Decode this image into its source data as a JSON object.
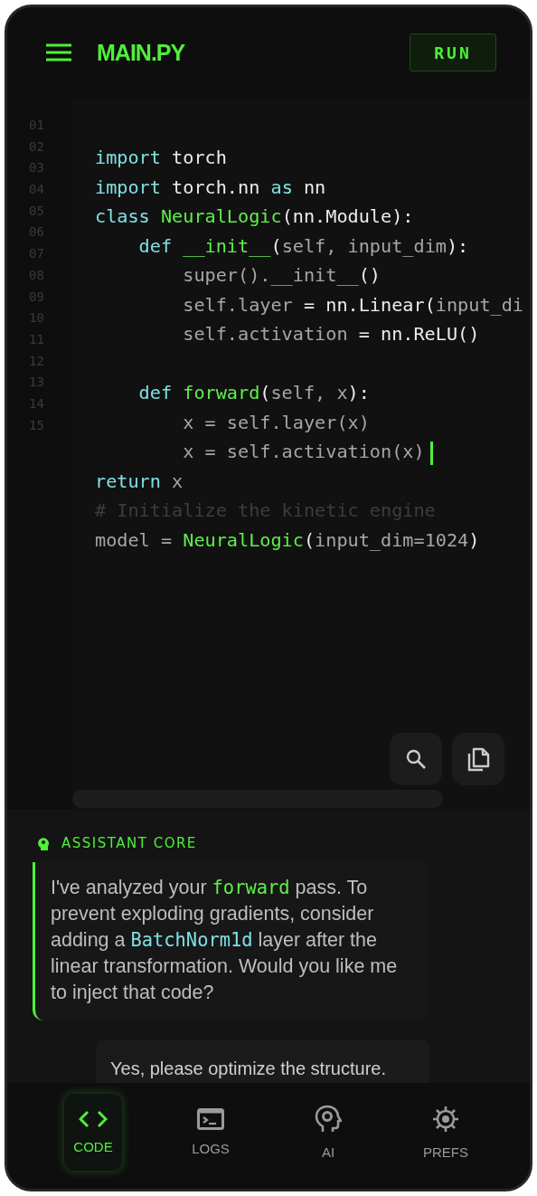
{
  "header": {
    "title": "MAIN.PY",
    "run_button": "RUN"
  },
  "editor": {
    "line_numbers": [
      "01",
      "02",
      "03",
      "04",
      "05",
      "06",
      "07",
      "08",
      "09",
      "10",
      "11",
      "12",
      "13",
      "14",
      "15"
    ],
    "lines": [
      {
        "kind": "code",
        "cursor": false,
        "tokens": [
          {
            "text": "import",
            "kind": "keyword"
          },
          {
            "text": " torch",
            "kind": "plain"
          }
        ]
      },
      {
        "kind": "code",
        "cursor": false,
        "tokens": [
          {
            "text": "import",
            "kind": "keyword"
          },
          {
            "text": " torch.nn ",
            "kind": "plain"
          },
          {
            "text": "as",
            "kind": "keyword"
          },
          {
            "text": " nn",
            "kind": "plain"
          }
        ]
      },
      {
        "kind": "code",
        "cursor": false,
        "tokens": [
          {
            "text": "class",
            "kind": "keyword"
          },
          {
            "text": " NeuralLogic",
            "kind": "function"
          },
          {
            "text": "(nn.Module):",
            "kind": "plain"
          }
        ]
      },
      {
        "kind": "code",
        "cursor": false,
        "tokens": [
          {
            "text": "    def",
            "kind": "keyword"
          },
          {
            "text": " __init__",
            "kind": "function"
          },
          {
            "text": "(",
            "kind": "plain"
          },
          {
            "text": "self, input_dim",
            "kind": "muted"
          },
          {
            "text": "):",
            "kind": "plain"
          }
        ]
      },
      {
        "kind": "code",
        "cursor": false,
        "tokens": [
          {
            "text": "        super().__init__",
            "kind": "muted"
          },
          {
            "text": "()",
            "kind": "plain"
          }
        ]
      },
      {
        "kind": "code",
        "cursor": false,
        "tokens": [
          {
            "text": "        self.layer",
            "kind": "muted"
          },
          {
            "text": " = nn.Linear(",
            "kind": "plain"
          },
          {
            "text": "input_di",
            "kind": "muted"
          }
        ]
      },
      {
        "kind": "code",
        "cursor": false,
        "tokens": [
          {
            "text": "        self.activation",
            "kind": "muted"
          },
          {
            "text": " = nn.ReLU()",
            "kind": "plain"
          }
        ]
      },
      {
        "kind": "blank",
        "cursor": false
      },
      {
        "kind": "code",
        "cursor": false,
        "tokens": [
          {
            "text": "    def",
            "kind": "keyword"
          },
          {
            "text": " forward",
            "kind": "function"
          },
          {
            "text": "(",
            "kind": "plain"
          },
          {
            "text": "self, x",
            "kind": "muted"
          },
          {
            "text": "):",
            "kind": "plain"
          }
        ]
      },
      {
        "kind": "code",
        "cursor": false,
        "tokens": [
          {
            "text": "        x = self.layer(x)",
            "kind": "muted"
          }
        ]
      },
      {
        "kind": "code",
        "cursor": true,
        "tokens": [
          {
            "text": "        x = self.activation(x)",
            "kind": "muted"
          }
        ]
      },
      {
        "kind": "code",
        "cursor": false,
        "tokens": [
          {
            "text": "return",
            "kind": "keyword"
          },
          {
            "text": " x",
            "kind": "muted"
          }
        ]
      },
      {
        "kind": "code",
        "cursor": false,
        "tokens": [
          {
            "text": "# Initialize the kinetic engine",
            "kind": "comment"
          }
        ]
      },
      {
        "kind": "code",
        "cursor": false,
        "tokens": [
          {
            "text": "model = ",
            "kind": "muted"
          },
          {
            "text": "NeuralLogic",
            "kind": "function"
          },
          {
            "text": "(",
            "kind": "plain"
          },
          {
            "text": "input_dim=1024",
            "kind": "muted"
          },
          {
            "text": ")",
            "kind": "plain"
          }
        ]
      }
    ]
  },
  "assistant": {
    "label": "ASSISTANT CORE",
    "message": [
      {
        "text": "I've analyzed your ",
        "kind": "plain"
      },
      {
        "text": "forward",
        "kind": "code_green"
      },
      {
        "text": " pass. To prevent exploding gradients, consider adding a ",
        "kind": "plain"
      },
      {
        "text": "BatchNorm1d",
        "kind": "code_cyan"
      },
      {
        "text": " layer after the linear transformation. Would you like me to inject that code?",
        "kind": "plain"
      }
    ],
    "reply": "Yes, please optimize the structure."
  },
  "nav": [
    {
      "label": "CODE",
      "selected": true
    },
    {
      "label": "LOGS",
      "selected": false
    },
    {
      "label": "AI",
      "selected": false
    },
    {
      "label": "PREFS",
      "selected": false
    }
  ]
}
